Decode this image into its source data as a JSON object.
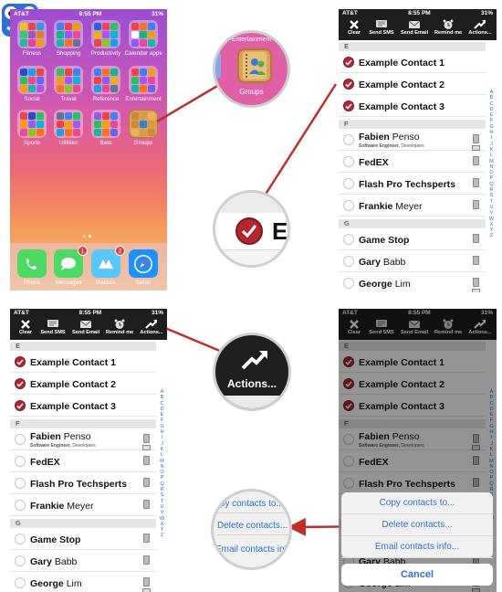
{
  "status": {
    "carrier": "AT&T",
    "signal": "●●●○○",
    "time": "8:55 PM",
    "battery": "31%"
  },
  "home": {
    "folders": [
      {
        "label": "Fitness",
        "colors": [
          "#f1c40f",
          "#e74c3c",
          "#3498db",
          "#2ecc71",
          "#9b59b6",
          "#e67e22",
          "#1abc9c",
          "#e84393",
          "#f39c12"
        ]
      },
      {
        "label": "Shopping",
        "colors": [
          "#3b82f6",
          "#ef4444",
          "#f59e0b",
          "#10b981",
          "#8b5cf6",
          "#ec4899",
          "#14b8a6",
          "#f97316",
          "#64748b"
        ]
      },
      {
        "label": "Productivity",
        "colors": [
          "#2563eb",
          "#f43f5e",
          "#22c55e",
          "#eab308",
          "#a855f7",
          "#06b6d4",
          "#ef4444",
          "#84cc16",
          "#0ea5e9"
        ]
      },
      {
        "label": "Calendar apps",
        "colors": [
          "#ef4444",
          "#f97316",
          "#3b82f6",
          "#ffffff",
          "#10b981",
          "#f59e0b",
          "#8b5cf6",
          "#ec4899",
          "#14b8a6"
        ]
      },
      {
        "label": "Social",
        "colors": [
          "#1d4ed8",
          "#0ea5e9",
          "#ef4444",
          "#22c55e",
          "#ec4899",
          "#6366f1",
          "#f59e0b",
          "#14b8a6",
          "#a855f7"
        ]
      },
      {
        "label": "Travel",
        "colors": [
          "#22c55e",
          "#ef4444",
          "#3b82f6",
          "#f59e0b",
          "#a855f7",
          "#06b6d4",
          "#f97316",
          "#84cc16",
          "#ec4899"
        ]
      },
      {
        "label": "Reference",
        "colors": [
          "#3b82f6",
          "#f97316",
          "#10b981",
          "#ef4444",
          "#8b5cf6",
          "#eab308",
          "#0ea5e9",
          "#ec4899",
          "#64748b"
        ]
      },
      {
        "label": "Entertainment",
        "colors": [
          "#ef4444",
          "#3b82f6",
          "#f59e0b",
          "#22c55e",
          "#a855f7",
          "#ec4899",
          "#14b8a6",
          "#f97316",
          "#6366f1"
        ]
      },
      {
        "label": "Sports",
        "colors": [
          "#ef4444",
          "#1d4ed8",
          "#22c55e",
          "#f59e0b",
          "#8b5cf6",
          "#06b6d4",
          "#ec4899",
          "#84cc16",
          "#f97316"
        ]
      },
      {
        "label": "Utilities",
        "colors": [
          "#64748b",
          "#3b82f6",
          "#22c55e",
          "#ef4444",
          "#f59e0b",
          "#a855f7",
          "#0ea5e9",
          "#f97316",
          "#ec4899"
        ]
      },
      {
        "label": "Beta",
        "colors": [
          "#8b5cf6",
          "#ef4444",
          "#3b82f6",
          "#22c55e",
          "#f59e0b",
          "#ec4899",
          "#14b8a6",
          "#f97316",
          "#6366f1"
        ]
      },
      {
        "label": "Groups",
        "colors": [
          "#c98a3a",
          "#d99b45",
          "#e8b55a",
          "#c98a3a",
          "#2f7fd6",
          "#d99b45",
          "#e8b55a",
          "#d99b45",
          "#c98a3a"
        ]
      }
    ],
    "dock": [
      {
        "label": "Phone",
        "color": "#4cd964",
        "icon": "phone-icon"
      },
      {
        "label": "Messages",
        "color": "#4cd964",
        "icon": "speech-bubble-icon",
        "badge": "1"
      },
      {
        "label": "Mailbox",
        "color": "#5ac8fa",
        "icon": "mailbox-icon",
        "badge": "2"
      },
      {
        "label": "Safari",
        "color": "#1e90ff",
        "icon": "compass-icon"
      }
    ]
  },
  "zoom": {
    "groups_top": "Entertainment",
    "groups_label": "Groups",
    "letter_e": "E",
    "actions_label": "Actions...",
    "menu_items": [
      "Copy contacts to...",
      "Delete contacts...",
      "Email contacts info..."
    ]
  },
  "toolbar": {
    "buttons": [
      {
        "label": "Clear",
        "icon": "x-icon"
      },
      {
        "label": "Send SMS",
        "icon": "sms-icon"
      },
      {
        "label": "Send Email",
        "icon": "envelope-icon"
      },
      {
        "label": "Remind me",
        "icon": "alarm-clock-icon"
      },
      {
        "label": "Actions...",
        "icon": "share-arrow-icon"
      }
    ]
  },
  "contacts": {
    "sections": [
      "E",
      "F",
      "G"
    ],
    "e_rows": [
      {
        "name": "Example Contact 1",
        "selected": true
      },
      {
        "name": "Example Contact 2",
        "selected": true
      },
      {
        "name": "Example Contact 3",
        "selected": true
      }
    ],
    "f_rows": [
      {
        "first": "Fabien",
        "last": "Penso",
        "sub": "Software Engineer,",
        "sub2": "Developers"
      },
      {
        "first": "FedEX",
        "last": ""
      },
      {
        "first": "Flash Pro Techsperts",
        "last": ""
      },
      {
        "first": "Frankie",
        "last": "Meyer"
      }
    ],
    "g_rows": [
      {
        "first": "Game Stop",
        "last": ""
      },
      {
        "first": "Gary",
        "last": "Babb"
      },
      {
        "first": "George",
        "last": "Lim"
      }
    ],
    "index": [
      "A",
      "B",
      "C",
      "D",
      "E",
      "F",
      "G",
      "H",
      "I",
      "J",
      "K",
      "L",
      "M",
      "N",
      "O",
      "P",
      "Q",
      "R",
      "S",
      "T",
      "U",
      "V",
      "W",
      "X",
      "Y",
      "Z"
    ]
  },
  "action_sheet": {
    "items": [
      "Copy contacts to...",
      "Delete contacts...",
      "Email contacts info..."
    ],
    "cancel": "Cancel"
  },
  "colors": {
    "accent": "#b3262f",
    "link": "#2f6fd6",
    "toolbar": "#1e1e1e",
    "arrow": "#c0302a"
  }
}
